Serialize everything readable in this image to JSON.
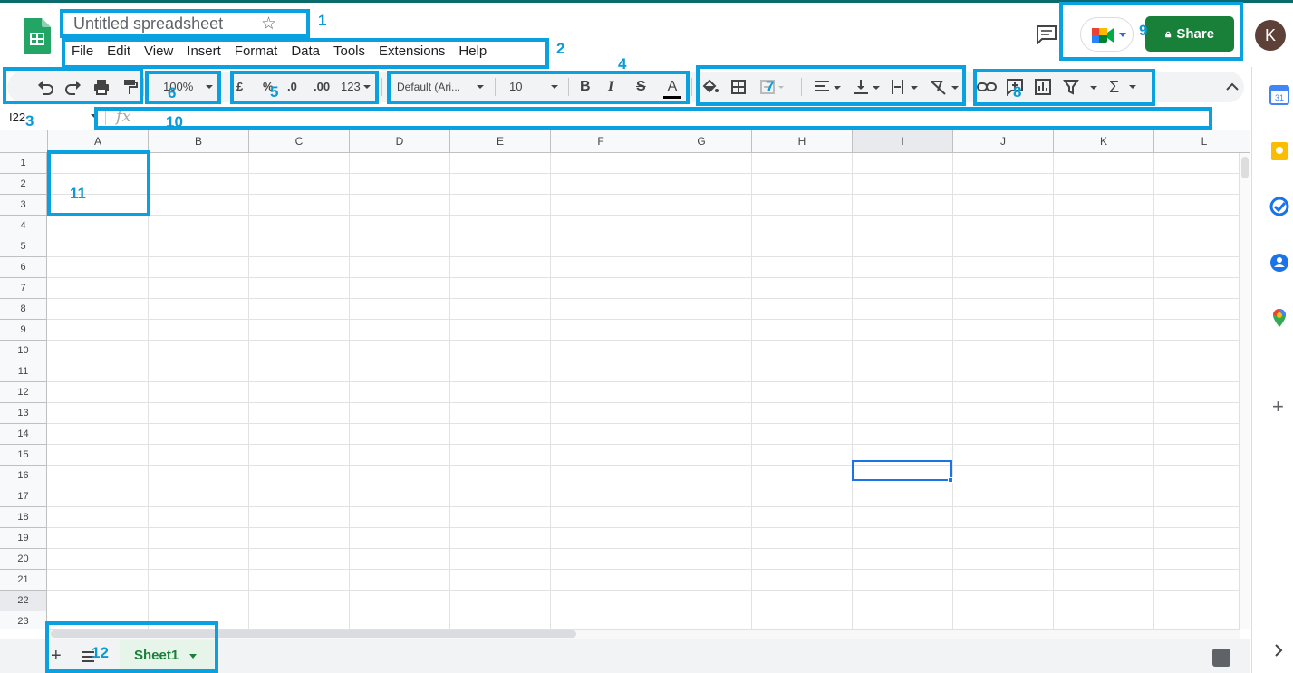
{
  "app": {
    "title": "Untitled spreadsheet",
    "menu": [
      "File",
      "Edit",
      "View",
      "Insert",
      "Format",
      "Data",
      "Tools",
      "Extensions",
      "Help"
    ],
    "share_label": "Share",
    "avatar_initial": "K",
    "accent_color": "#188038",
    "selection_color": "#1a73e8",
    "annotation_color": "#0aa1e0"
  },
  "toolbar": {
    "zoom": "100%",
    "currency": "£",
    "percent": "%",
    "decrease_decimal": ".0",
    "increase_decimal": ".00",
    "more_formats": "123",
    "font": "Default (Ari...",
    "font_size": "10",
    "bold": "B",
    "italic": "I",
    "strikethrough": "S",
    "text_color": "A",
    "functions": "Σ"
  },
  "formula_bar": {
    "name_box": "I22",
    "fx": "fx"
  },
  "grid": {
    "columns": [
      "A",
      "B",
      "C",
      "D",
      "E",
      "F",
      "G",
      "H",
      "I",
      "J",
      "K",
      "L"
    ],
    "rows": [
      "1",
      "2",
      "3",
      "4",
      "5",
      "6",
      "7",
      "8",
      "9",
      "10",
      "11",
      "12",
      "13",
      "14",
      "15",
      "16",
      "17",
      "18",
      "19",
      "20",
      "21",
      "22",
      "23"
    ],
    "selected_cell": "I22"
  },
  "sheets": {
    "active": "Sheet1"
  },
  "annotations": [
    "1",
    "2",
    "3",
    "4",
    "5",
    "6",
    "7",
    "8",
    "9",
    "10",
    "11",
    "12"
  ],
  "side_panel_icons": [
    "calendar-icon",
    "keep-icon",
    "tasks-icon",
    "contacts-icon",
    "maps-icon",
    "add-icon"
  ]
}
